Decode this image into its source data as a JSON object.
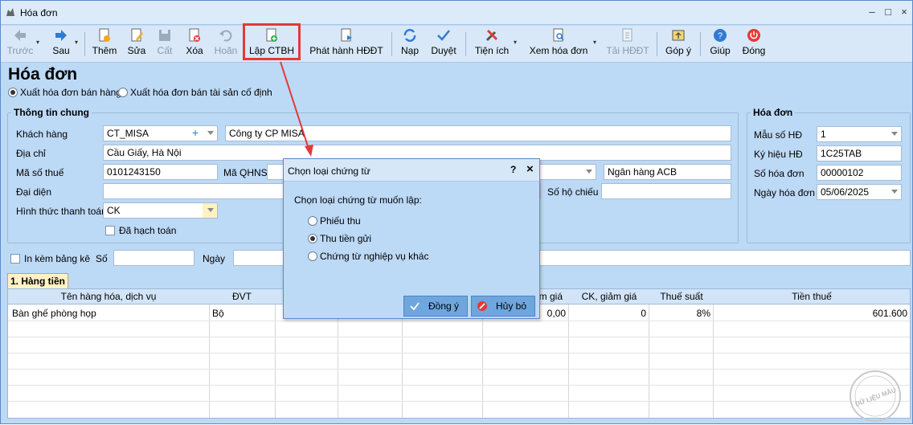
{
  "window": {
    "title": "Hóa đơn",
    "minimize": "–",
    "maximize": "□",
    "close": "×"
  },
  "toolbar": {
    "prev": "Trước",
    "next": "Sau",
    "add": "Thêm",
    "edit": "Sửa",
    "cut": "Cất",
    "delete": "Xóa",
    "undo": "Hoãn",
    "create_ctbh": "Lập CTBH",
    "issue_einvoice": "Phát hành HĐĐT",
    "reload": "Nạp",
    "approve": "Duyệt",
    "utilities": "Tiện ích",
    "view_invoice": "Xem hóa đơn",
    "download_einvoice": "Tải HĐĐT",
    "feedback": "Góp ý",
    "help": "Giúp",
    "close": "Đóng"
  },
  "page": {
    "title": "Hóa đơn",
    "radio_sales": "Xuất hóa đơn bán hàng",
    "radio_asset": "Xuất hóa đơn bán tài sản cố định"
  },
  "general": {
    "legend": "Thông tin chung",
    "customer_label": "Khách hàng",
    "customer_code": "CT_MISA",
    "customer_plus": "+",
    "customer_name": "Công ty CP MISA",
    "address_label": "Địa chỉ",
    "address": "Cầu Giấy, Hà Nội",
    "tax_label": "Mã số thuế",
    "tax_code": "0101243150",
    "qhns_label": "Mã QHNS",
    "bank": "Ngân hàng ACB",
    "rep_label": "Đại diện",
    "passport_label": "Số hộ chiếu",
    "payment_label": "Hình thức thanh toán",
    "payment": "CK",
    "posted_label": "Đã hạch toán"
  },
  "invoice": {
    "legend": "Hóa đơn",
    "template_label": "Mẫu số HĐ",
    "template": "1",
    "symbol_label": "Ký hiệu HĐ",
    "symbol": "1C25TAB",
    "number_label": "Số hóa đơn",
    "number": "00000102",
    "date_label": "Ngày hóa đơn",
    "date": "05/06/2025"
  },
  "attach": {
    "label": "In kèm bảng kê",
    "no_label": "Số",
    "date_label": "Ngày"
  },
  "grid": {
    "tab": "1. Hàng tiền",
    "headers": {
      "item": "Tên hàng hóa, dịch vụ",
      "unit": "ĐVT",
      "price_frag": "m giá",
      "discount": "CK, giảm giá",
      "tax_rate": "Thuế suất",
      "tax_amount": "Tiền thuế"
    },
    "row": {
      "item": "Bàn ghế phòng họp",
      "unit": "Bộ",
      "price": "0,00",
      "discount": "0",
      "tax_rate": "8%",
      "tax_amount": "601.600"
    }
  },
  "dialog": {
    "title": "Chọn loại chứng từ",
    "help": "?",
    "close": "×",
    "prompt": "Chọn loại chứng từ muốn lập:",
    "options": [
      "Phiếu thu",
      "Thu tiền gửi",
      "Chứng từ nghiệp vụ khác"
    ],
    "selected": "Thu tiền gửi",
    "ok": "Đồng ý",
    "cancel": "Hủy bỏ"
  },
  "watermark": {
    "text": "DỮ LIỆU MẪU"
  },
  "colors": {
    "highlight": "#e53935",
    "accent": "#6fa6dd",
    "background": "#bcd9f6"
  }
}
